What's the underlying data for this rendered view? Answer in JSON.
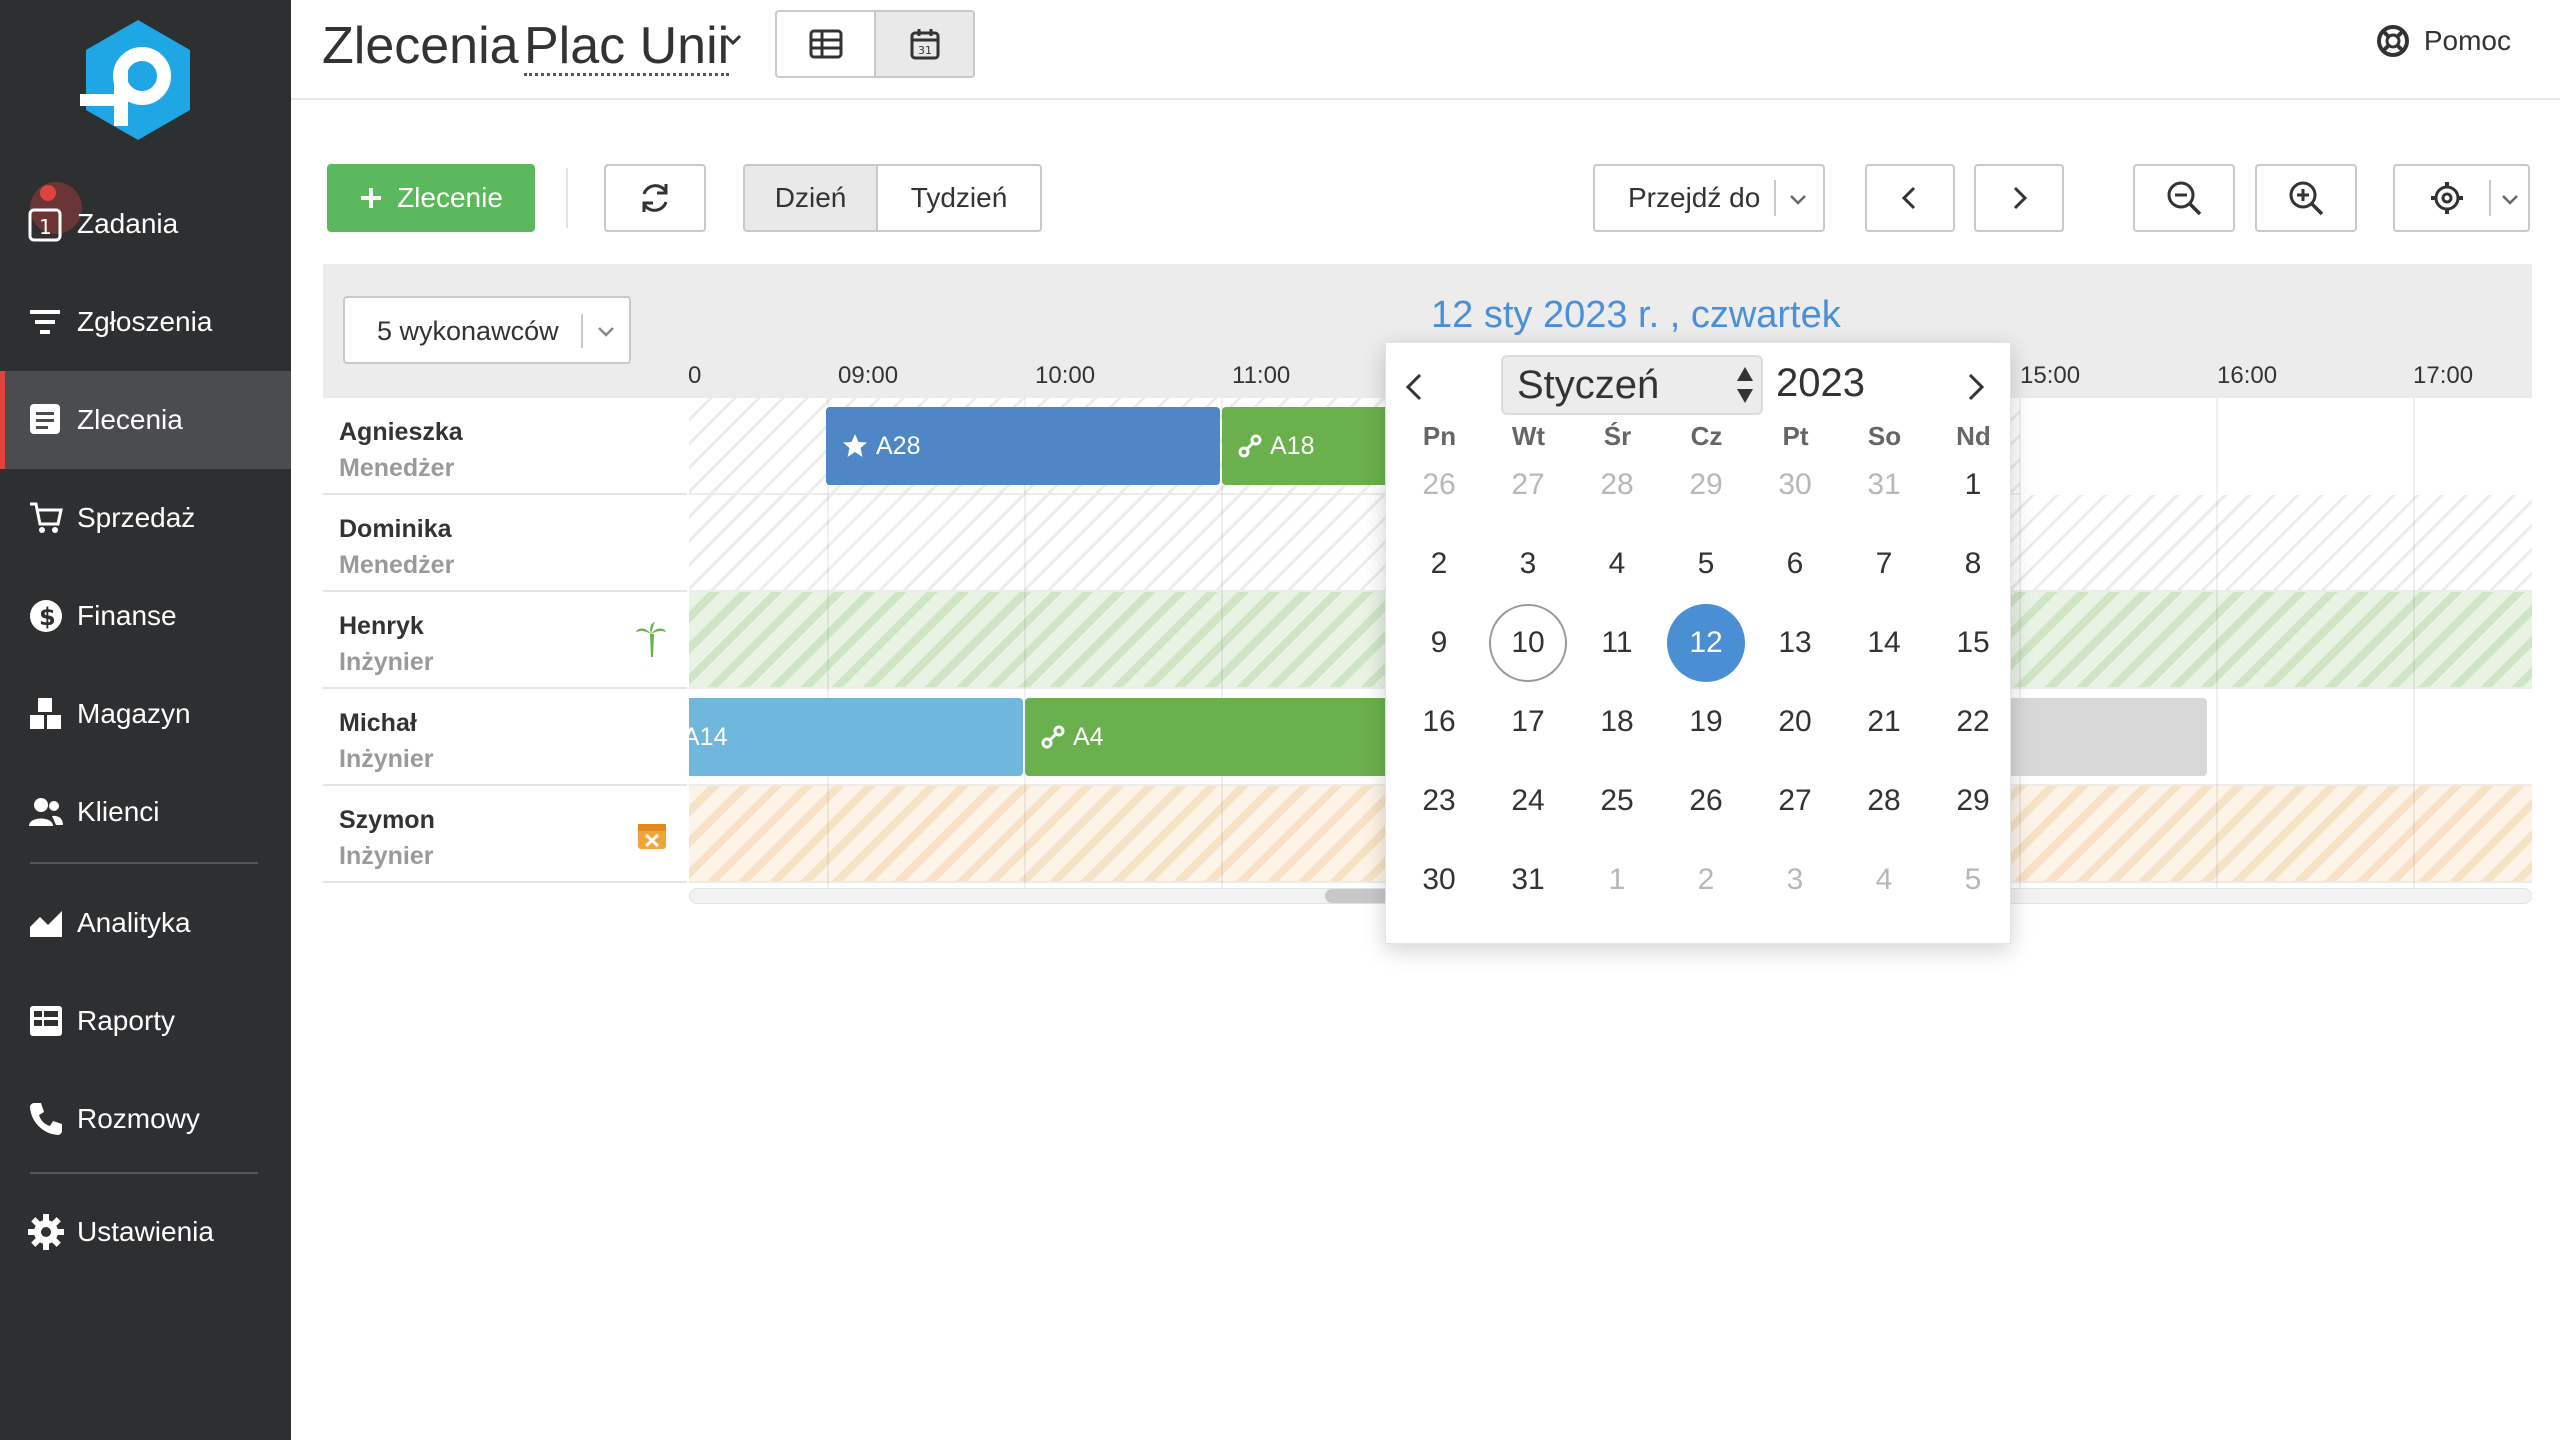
{
  "header": {
    "title": "Zlecenia",
    "location": "Plac Unii",
    "help_label": "Pomoc"
  },
  "sidebar": {
    "items": [
      {
        "label": "Zadania",
        "icon": "tasks-icon",
        "badge": "1"
      },
      {
        "label": "Zgłoszenia",
        "icon": "filter-icon"
      },
      {
        "label": "Zlecenia",
        "icon": "orders-icon",
        "active": true
      },
      {
        "label": "Sprzedaż",
        "icon": "cart-icon"
      },
      {
        "label": "Finanse",
        "icon": "dollar-icon"
      },
      {
        "label": "Magazyn",
        "icon": "boxes-icon"
      },
      {
        "label": "Klienci",
        "icon": "users-icon"
      },
      {
        "label": "Analityka",
        "icon": "chart-icon"
      },
      {
        "label": "Raporty",
        "icon": "reports-icon"
      },
      {
        "label": "Rozmowy",
        "icon": "phone-icon"
      },
      {
        "label": "Ustawienia",
        "icon": "gear-icon"
      }
    ]
  },
  "toolbar": {
    "new_order_label": "Zlecenie",
    "day_label": "Dzień",
    "week_label": "Tydzień",
    "goto_label": "Przejdź do"
  },
  "scheduler": {
    "date_title": "12 sty 2023 r. , czwartek",
    "resources_filter": "5 wykonawców",
    "time_labels": [
      "0",
      "09:00",
      "10:00",
      "11:00",
      "15:00",
      "16:00",
      "17:00"
    ],
    "resources": [
      {
        "name": "Agnieszka",
        "role": "Menedżer"
      },
      {
        "name": "Dominika",
        "role": "Menedżer"
      },
      {
        "name": "Henryk",
        "role": "Inżynier",
        "status_icon": "palm-tree-icon"
      },
      {
        "name": "Michał",
        "role": "Inżynier"
      },
      {
        "name": "Szymon",
        "role": "Inżynier",
        "status_icon": "calendar-x-icon"
      }
    ],
    "events": [
      {
        "label": "A28",
        "icon": "star-icon",
        "color": "#4f86c6"
      },
      {
        "label": "A18",
        "icon": "link-icon",
        "color": "#6ab04c"
      },
      {
        "label": "A14",
        "color": "#6fb7dc"
      },
      {
        "label": "A4",
        "icon": "link-icon",
        "color": "#6ab04c"
      }
    ]
  },
  "calendar": {
    "month": "Styczeń",
    "year": "2023",
    "weekdays": [
      "Pn",
      "Wt",
      "Śr",
      "Cz",
      "Pt",
      "So",
      "Nd"
    ],
    "days": [
      "26",
      "27",
      "28",
      "29",
      "30",
      "31",
      "1",
      "2",
      "3",
      "4",
      "5",
      "6",
      "7",
      "8",
      "9",
      "10",
      "11",
      "12",
      "13",
      "14",
      "15",
      "16",
      "17",
      "18",
      "19",
      "20",
      "21",
      "22",
      "23",
      "24",
      "25",
      "26",
      "27",
      "28",
      "29",
      "30",
      "31",
      "1",
      "2",
      "3",
      "4",
      "5"
    ],
    "today": "10",
    "selected": "12",
    "accent_color": "#4a8fd4"
  },
  "colors": {
    "sidebar_bg": "#2d2f31",
    "primary_green": "#5cb85c",
    "link_blue": "#4a90d9",
    "active_marker": "#e0433f"
  }
}
